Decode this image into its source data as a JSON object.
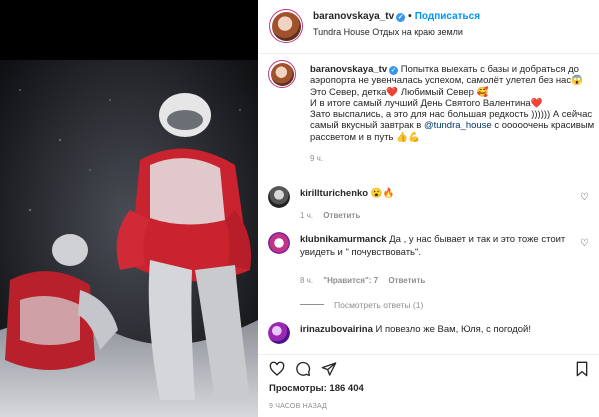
{
  "post": {
    "username": "baranovskaya_tv",
    "follow_label": "Подписаться",
    "location": "Tundra House Отдых на краю земли",
    "caption_line1": "Попытка выехать с базы и добраться до аэропорта не увенчалась успехом, самолёт улетел без нас😱",
    "caption_line2": "Это Север, детка❤️ Любимый Север 🥰",
    "caption_line3": "И в итоге самый лучший День Святого Валентина❤️",
    "caption_line4a": "Зато выспались, а это для нас большая редкость )))))) А сейчас самый вкусный завтрак в ",
    "caption_mention": "@tundra_house",
    "caption_line4b": " с ооооочень красивым рассветом и в путь 👍💪",
    "time": "9 ч."
  },
  "comments": [
    {
      "username": "kirillturichenko",
      "text": "😮🔥",
      "time": "1 ч.",
      "reply": "Ответить"
    },
    {
      "username": "klubnikamurmanck",
      "text": "Да , у нас бывает и так и это тоже стоит увидеть и \" почувствовать\".",
      "time": "8 ч.",
      "likes": "\"Нравится\": 7",
      "reply": "Ответить",
      "show_replies": "Посмотреть ответы (1)"
    },
    {
      "username": "irinazubovairina",
      "text": "И повезло же Вам, Юля, с погодой!"
    }
  ],
  "stats": {
    "views": "Просмотры: 186 404",
    "ago": "9 ЧАСОВ НАЗАД"
  },
  "icons": {
    "like": "heart-icon",
    "comment": "comment-icon",
    "share": "share-icon",
    "save": "bookmark-icon"
  },
  "colors": {
    "link": "#0095f6",
    "verified": "#3897f0",
    "muted": "#8e8e8e"
  }
}
